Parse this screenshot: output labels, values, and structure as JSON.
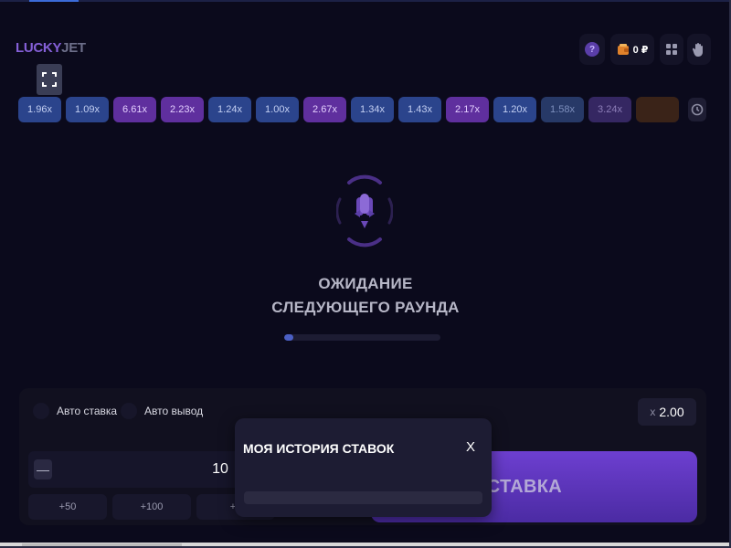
{
  "header": {
    "logo_part1": "LUCKY",
    "logo_part2": "JET",
    "help_icon": "?",
    "balance": "0 ₽"
  },
  "multipliers": [
    {
      "value": "1.96x",
      "style": "blue"
    },
    {
      "value": "1.09x",
      "style": "blue"
    },
    {
      "value": "6.61x",
      "style": "purple"
    },
    {
      "value": "2.23x",
      "style": "purple"
    },
    {
      "value": "1.24x",
      "style": "blue"
    },
    {
      "value": "1.00x",
      "style": "blue"
    },
    {
      "value": "2.67x",
      "style": "purple"
    },
    {
      "value": "1.34x",
      "style": "blue"
    },
    {
      "value": "1.43x",
      "style": "blue"
    },
    {
      "value": "2.17x",
      "style": "purple"
    },
    {
      "value": "1.20x",
      "style": "blue"
    },
    {
      "value": "1.58x",
      "style": "faded-blue"
    },
    {
      "value": "3.24x",
      "style": "faded-purple"
    },
    {
      "value": "",
      "style": "faded-orange"
    }
  ],
  "game": {
    "waiting_line1": "ОЖИДАНИЕ",
    "waiting_line2": "СЛЕДУЮЩЕГО РАУНДА",
    "progress": 0.06
  },
  "bet_panel": {
    "auto_bet_label": "Авто ставка",
    "auto_cashout_label": "Авто вывод",
    "auto_x_prefix": "x",
    "auto_x_value": "2.00",
    "minus_label": "—",
    "amount": "10",
    "quick_amounts": [
      "+50",
      "+100",
      "+2"
    ],
    "bet_button_label": "СТАВКА"
  },
  "modal": {
    "title": "МОЯ ИСТОРИЯ СТАВОК",
    "close_label": "X"
  },
  "colors": {
    "background": "#0b0a1c",
    "accent_purple": "#6d3fd0",
    "multiplier_blue": "#2b448c",
    "multiplier_purple": "#5f2f9e"
  }
}
